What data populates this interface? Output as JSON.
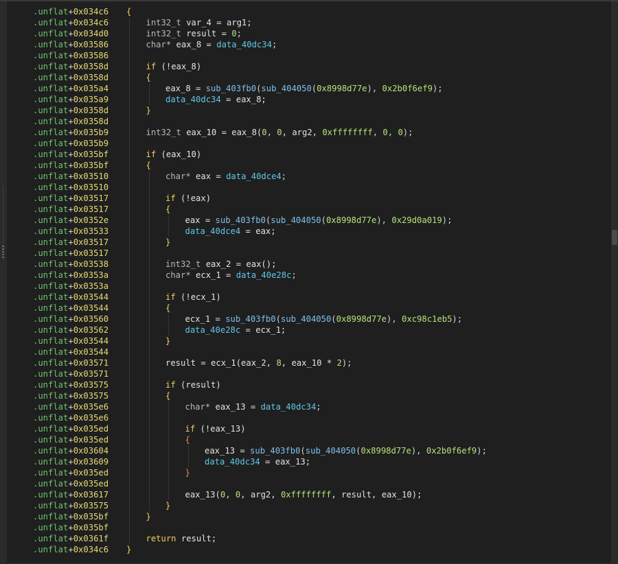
{
  "colors": {
    "background": "#1f1f1f",
    "address_prefix": "#6fc36f",
    "address_hex": "#e6db74",
    "keyword": "#f0d060",
    "data_symbol": "#5fc8e8",
    "function": "#7ec0ee",
    "number": "#b5e37b"
  },
  "lines": [
    {
      "addr_prefix": ".unflat",
      "addr_offset": "0x034c6",
      "indent": 0,
      "tokens": [
        {
          "t": "{",
          "c": "brace"
        }
      ]
    },
    {
      "addr_prefix": ".unflat",
      "addr_offset": "0x034c6",
      "indent": 1,
      "tokens": [
        {
          "t": "int32_t ",
          "c": "type"
        },
        {
          "t": "var_4 = arg1;",
          "c": "id"
        }
      ]
    },
    {
      "addr_prefix": ".unflat",
      "addr_offset": "0x034d0",
      "indent": 1,
      "tokens": [
        {
          "t": "int32_t ",
          "c": "type"
        },
        {
          "t": "result = ",
          "c": "id"
        },
        {
          "t": "0",
          "c": "num"
        },
        {
          "t": ";",
          "c": "punc"
        }
      ]
    },
    {
      "addr_prefix": ".unflat",
      "addr_offset": "0x03586",
      "indent": 1,
      "tokens": [
        {
          "t": "char* ",
          "c": "type"
        },
        {
          "t": "eax_8 = ",
          "c": "id"
        },
        {
          "t": "data_40dc34",
          "c": "data"
        },
        {
          "t": ";",
          "c": "punc"
        }
      ]
    },
    {
      "addr_prefix": ".unflat",
      "addr_offset": "0x03586",
      "indent": 0,
      "tokens": []
    },
    {
      "addr_prefix": ".unflat",
      "addr_offset": "0x0358d",
      "indent": 1,
      "tokens": [
        {
          "t": "if",
          "c": "kw"
        },
        {
          "t": " (!eax_8)",
          "c": "id"
        }
      ]
    },
    {
      "addr_prefix": ".unflat",
      "addr_offset": "0x0358d",
      "indent": 1,
      "tokens": [
        {
          "t": "{",
          "c": "brace"
        }
      ]
    },
    {
      "addr_prefix": ".unflat",
      "addr_offset": "0x035a4",
      "indent": 2,
      "tokens": [
        {
          "t": "eax_8 = ",
          "c": "id"
        },
        {
          "t": "sub_403fb0",
          "c": "func"
        },
        {
          "t": "(",
          "c": "punc"
        },
        {
          "t": "sub_404050",
          "c": "func"
        },
        {
          "t": "(",
          "c": "punc"
        },
        {
          "t": "0x8998d77e",
          "c": "num"
        },
        {
          "t": "), ",
          "c": "punc"
        },
        {
          "t": "0x2b0f6ef9",
          "c": "num"
        },
        {
          "t": ");",
          "c": "punc"
        }
      ]
    },
    {
      "addr_prefix": ".unflat",
      "addr_offset": "0x035a9",
      "indent": 2,
      "tokens": [
        {
          "t": "data_40dc34",
          "c": "data"
        },
        {
          "t": " = eax_8;",
          "c": "id"
        }
      ]
    },
    {
      "addr_prefix": ".unflat",
      "addr_offset": "0x0358d",
      "indent": 1,
      "tokens": [
        {
          "t": "}",
          "c": "brace"
        }
      ]
    },
    {
      "addr_prefix": ".unflat",
      "addr_offset": "0x0358d",
      "indent": 0,
      "tokens": []
    },
    {
      "addr_prefix": ".unflat",
      "addr_offset": "0x035b9",
      "indent": 1,
      "tokens": [
        {
          "t": "int32_t ",
          "c": "type"
        },
        {
          "t": "eax_10 = eax_8(",
          "c": "id"
        },
        {
          "t": "0",
          "c": "num"
        },
        {
          "t": ", ",
          "c": "punc"
        },
        {
          "t": "0",
          "c": "num"
        },
        {
          "t": ", arg2, ",
          "c": "id"
        },
        {
          "t": "0xffffffff",
          "c": "num"
        },
        {
          "t": ", ",
          "c": "punc"
        },
        {
          "t": "0",
          "c": "num"
        },
        {
          "t": ", ",
          "c": "punc"
        },
        {
          "t": "0",
          "c": "num"
        },
        {
          "t": ");",
          "c": "punc"
        }
      ]
    },
    {
      "addr_prefix": ".unflat",
      "addr_offset": "0x035b9",
      "indent": 0,
      "tokens": []
    },
    {
      "addr_prefix": ".unflat",
      "addr_offset": "0x035bf",
      "indent": 1,
      "tokens": [
        {
          "t": "if",
          "c": "kw"
        },
        {
          "t": " (eax_10)",
          "c": "id"
        }
      ]
    },
    {
      "addr_prefix": ".unflat",
      "addr_offset": "0x035bf",
      "indent": 1,
      "tokens": [
        {
          "t": "{",
          "c": "brace"
        }
      ]
    },
    {
      "addr_prefix": ".unflat",
      "addr_offset": "0x03510",
      "indent": 2,
      "tokens": [
        {
          "t": "char* ",
          "c": "type"
        },
        {
          "t": "eax = ",
          "c": "id"
        },
        {
          "t": "data_40dce4",
          "c": "data"
        },
        {
          "t": ";",
          "c": "punc"
        }
      ]
    },
    {
      "addr_prefix": ".unflat",
      "addr_offset": "0x03510",
      "indent": 0,
      "tokens": []
    },
    {
      "addr_prefix": ".unflat",
      "addr_offset": "0x03517",
      "indent": 2,
      "tokens": [
        {
          "t": "if",
          "c": "kw"
        },
        {
          "t": " (!eax)",
          "c": "id"
        }
      ]
    },
    {
      "addr_prefix": ".unflat",
      "addr_offset": "0x03517",
      "indent": 2,
      "tokens": [
        {
          "t": "{",
          "c": "brace"
        }
      ]
    },
    {
      "addr_prefix": ".unflat",
      "addr_offset": "0x0352e",
      "indent": 3,
      "tokens": [
        {
          "t": "eax = ",
          "c": "id"
        },
        {
          "t": "sub_403fb0",
          "c": "func"
        },
        {
          "t": "(",
          "c": "punc"
        },
        {
          "t": "sub_404050",
          "c": "func"
        },
        {
          "t": "(",
          "c": "punc"
        },
        {
          "t": "0x8998d77e",
          "c": "num"
        },
        {
          "t": "), ",
          "c": "punc"
        },
        {
          "t": "0x29d0a019",
          "c": "num"
        },
        {
          "t": ");",
          "c": "punc"
        }
      ]
    },
    {
      "addr_prefix": ".unflat",
      "addr_offset": "0x03533",
      "indent": 3,
      "tokens": [
        {
          "t": "data_40dce4",
          "c": "data"
        },
        {
          "t": " = eax;",
          "c": "id"
        }
      ]
    },
    {
      "addr_prefix": ".unflat",
      "addr_offset": "0x03517",
      "indent": 2,
      "tokens": [
        {
          "t": "}",
          "c": "brace"
        }
      ]
    },
    {
      "addr_prefix": ".unflat",
      "addr_offset": "0x03517",
      "indent": 0,
      "tokens": []
    },
    {
      "addr_prefix": ".unflat",
      "addr_offset": "0x03538",
      "indent": 2,
      "tokens": [
        {
          "t": "int32_t ",
          "c": "type"
        },
        {
          "t": "eax_2 = eax();",
          "c": "id"
        }
      ]
    },
    {
      "addr_prefix": ".unflat",
      "addr_offset": "0x0353a",
      "indent": 2,
      "tokens": [
        {
          "t": "char* ",
          "c": "type"
        },
        {
          "t": "ecx_1 = ",
          "c": "id"
        },
        {
          "t": "data_40e28c",
          "c": "data"
        },
        {
          "t": ";",
          "c": "punc"
        }
      ]
    },
    {
      "addr_prefix": ".unflat",
      "addr_offset": "0x0353a",
      "indent": 0,
      "tokens": []
    },
    {
      "addr_prefix": ".unflat",
      "addr_offset": "0x03544",
      "indent": 2,
      "tokens": [
        {
          "t": "if",
          "c": "kw"
        },
        {
          "t": " (!ecx_1)",
          "c": "id"
        }
      ]
    },
    {
      "addr_prefix": ".unflat",
      "addr_offset": "0x03544",
      "indent": 2,
      "tokens": [
        {
          "t": "{",
          "c": "brace"
        }
      ]
    },
    {
      "addr_prefix": ".unflat",
      "addr_offset": "0x03560",
      "indent": 3,
      "tokens": [
        {
          "t": "ecx_1 = ",
          "c": "id"
        },
        {
          "t": "sub_403fb0",
          "c": "func"
        },
        {
          "t": "(",
          "c": "punc"
        },
        {
          "t": "sub_404050",
          "c": "func"
        },
        {
          "t": "(",
          "c": "punc"
        },
        {
          "t": "0x8998d77e",
          "c": "num"
        },
        {
          "t": "), ",
          "c": "punc"
        },
        {
          "t": "0xc98c1eb5",
          "c": "num"
        },
        {
          "t": ");",
          "c": "punc"
        }
      ]
    },
    {
      "addr_prefix": ".unflat",
      "addr_offset": "0x03562",
      "indent": 3,
      "tokens": [
        {
          "t": "data_40e28c",
          "c": "data"
        },
        {
          "t": " = ecx_1;",
          "c": "id"
        }
      ]
    },
    {
      "addr_prefix": ".unflat",
      "addr_offset": "0x03544",
      "indent": 2,
      "tokens": [
        {
          "t": "}",
          "c": "brace"
        }
      ]
    },
    {
      "addr_prefix": ".unflat",
      "addr_offset": "0x03544",
      "indent": 0,
      "tokens": []
    },
    {
      "addr_prefix": ".unflat",
      "addr_offset": "0x03571",
      "indent": 2,
      "tokens": [
        {
          "t": "result = ecx_1(eax_2, ",
          "c": "id"
        },
        {
          "t": "8",
          "c": "num"
        },
        {
          "t": ", eax_10 * ",
          "c": "id"
        },
        {
          "t": "2",
          "c": "num"
        },
        {
          "t": ");",
          "c": "punc"
        }
      ]
    },
    {
      "addr_prefix": ".unflat",
      "addr_offset": "0x03571",
      "indent": 0,
      "tokens": []
    },
    {
      "addr_prefix": ".unflat",
      "addr_offset": "0x03575",
      "indent": 2,
      "tokens": [
        {
          "t": "if",
          "c": "kw"
        },
        {
          "t": " (result)",
          "c": "id"
        }
      ]
    },
    {
      "addr_prefix": ".unflat",
      "addr_offset": "0x03575",
      "indent": 2,
      "tokens": [
        {
          "t": "{",
          "c": "brace"
        }
      ]
    },
    {
      "addr_prefix": ".unflat",
      "addr_offset": "0x035e6",
      "indent": 3,
      "tokens": [
        {
          "t": "char* ",
          "c": "type"
        },
        {
          "t": "eax_13 = ",
          "c": "id"
        },
        {
          "t": "data_40dc34",
          "c": "data"
        },
        {
          "t": ";",
          "c": "punc"
        }
      ]
    },
    {
      "addr_prefix": ".unflat",
      "addr_offset": "0x035e6",
      "indent": 0,
      "tokens": []
    },
    {
      "addr_prefix": ".unflat",
      "addr_offset": "0x035ed",
      "indent": 3,
      "tokens": [
        {
          "t": "if",
          "c": "kw"
        },
        {
          "t": " (!eax_13)",
          "c": "id"
        }
      ]
    },
    {
      "addr_prefix": ".unflat",
      "addr_offset": "0x035ed",
      "indent": 3,
      "tokens": [
        {
          "t": "{",
          "c": "brace2"
        }
      ]
    },
    {
      "addr_prefix": ".unflat",
      "addr_offset": "0x03604",
      "indent": 4,
      "tokens": [
        {
          "t": "eax_13 = ",
          "c": "id"
        },
        {
          "t": "sub_403fb0",
          "c": "func"
        },
        {
          "t": "(",
          "c": "punc"
        },
        {
          "t": "sub_404050",
          "c": "func"
        },
        {
          "t": "(",
          "c": "punc"
        },
        {
          "t": "0x8998d77e",
          "c": "num"
        },
        {
          "t": "), ",
          "c": "punc"
        },
        {
          "t": "0x2b0f6ef9",
          "c": "num"
        },
        {
          "t": ");",
          "c": "punc"
        }
      ]
    },
    {
      "addr_prefix": ".unflat",
      "addr_offset": "0x03609",
      "indent": 4,
      "tokens": [
        {
          "t": "data_40dc34",
          "c": "data"
        },
        {
          "t": " = eax_13;",
          "c": "id"
        }
      ]
    },
    {
      "addr_prefix": ".unflat",
      "addr_offset": "0x035ed",
      "indent": 3,
      "tokens": [
        {
          "t": "}",
          "c": "brace2"
        }
      ]
    },
    {
      "addr_prefix": ".unflat",
      "addr_offset": "0x035ed",
      "indent": 0,
      "tokens": []
    },
    {
      "addr_prefix": ".unflat",
      "addr_offset": "0x03617",
      "indent": 3,
      "tokens": [
        {
          "t": "eax_13(",
          "c": "id"
        },
        {
          "t": "0",
          "c": "num"
        },
        {
          "t": ", ",
          "c": "punc"
        },
        {
          "t": "0",
          "c": "num"
        },
        {
          "t": ", arg2, ",
          "c": "id"
        },
        {
          "t": "0xffffffff",
          "c": "num"
        },
        {
          "t": ", result, eax_10);",
          "c": "id"
        }
      ]
    },
    {
      "addr_prefix": ".unflat",
      "addr_offset": "0x03575",
      "indent": 2,
      "tokens": [
        {
          "t": "}",
          "c": "brace"
        }
      ]
    },
    {
      "addr_prefix": ".unflat",
      "addr_offset": "0x035bf",
      "indent": 1,
      "tokens": [
        {
          "t": "}",
          "c": "brace"
        }
      ]
    },
    {
      "addr_prefix": ".unflat",
      "addr_offset": "0x035bf",
      "indent": 0,
      "tokens": []
    },
    {
      "addr_prefix": ".unflat",
      "addr_offset": "0x0361f",
      "indent": 1,
      "tokens": [
        {
          "t": "return",
          "c": "kw"
        },
        {
          "t": " result;",
          "c": "id"
        }
      ]
    },
    {
      "addr_prefix": ".unflat",
      "addr_offset": "0x034c6",
      "indent": 0,
      "tokens": [
        {
          "t": "}",
          "c": "brace"
        }
      ]
    }
  ]
}
